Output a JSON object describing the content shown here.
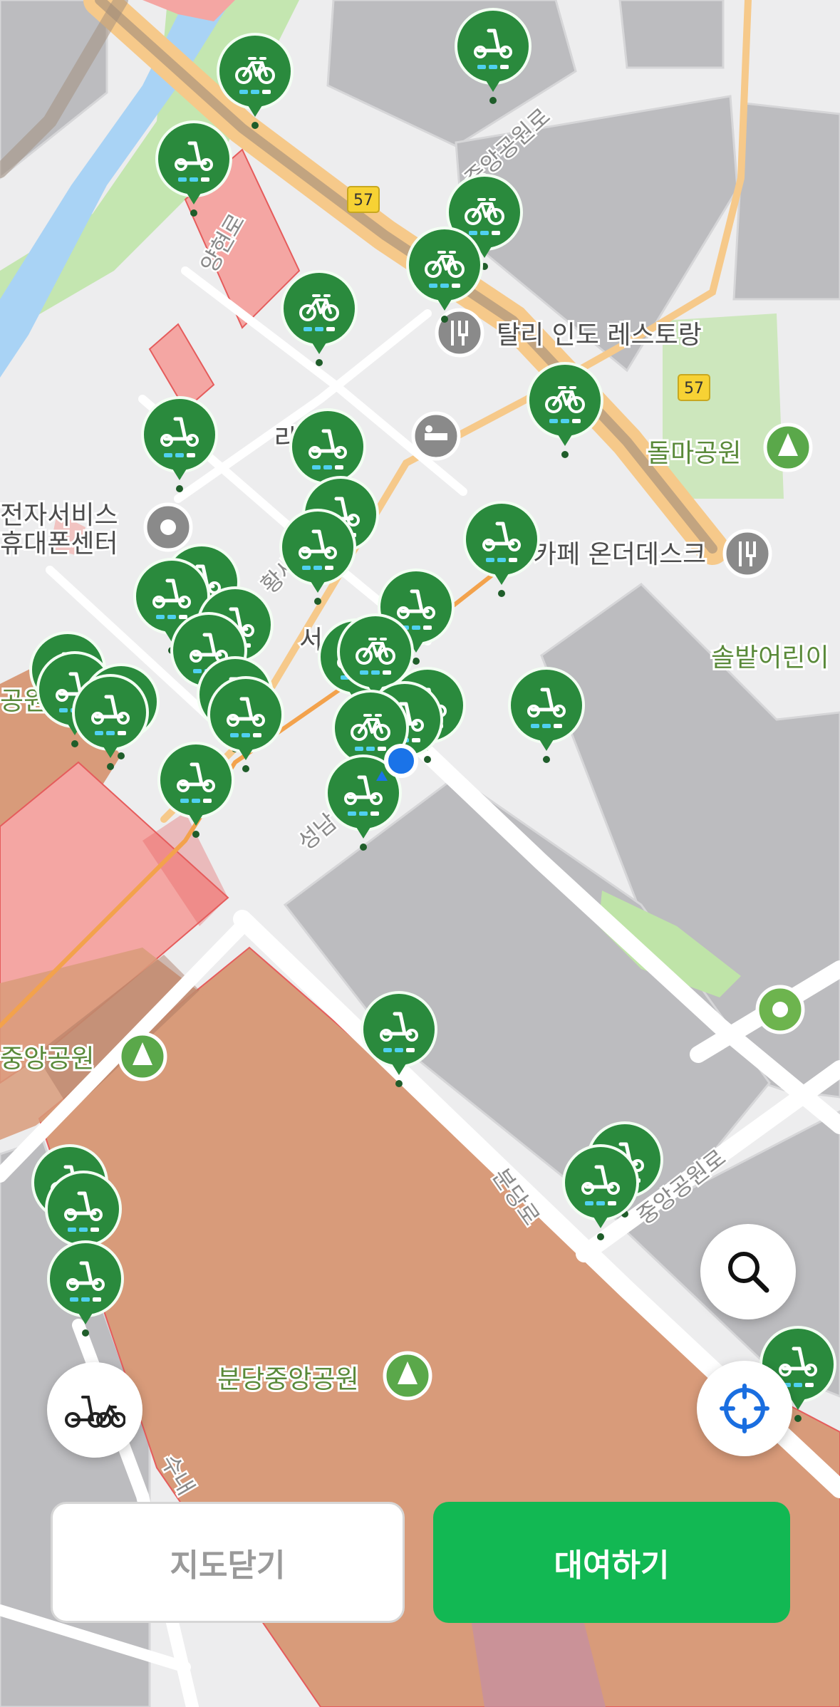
{
  "map": {
    "road_names": {
      "yanghyeon_ro": "양현로",
      "central_park_ro_top": "중앙공원로",
      "central_park_ro_bottom": "중앙공원로",
      "bundang_ro": "분당로",
      "seongnam_ro": "성남",
      "hwangsae_ul_ro": "황새",
      "suinae": "수내"
    },
    "route_badges": [
      "57",
      "57"
    ],
    "pois": {
      "tali_indo": "탈리 인도 레스토랑",
      "hotel": "라 호텔",
      "samsung_service_1": "전자서비스",
      "samsung_service_2": "휴대폰센터",
      "dolma_park": "돌마공원",
      "cafe": "카페 온더데스크",
      "solbat": "솔밭어린이",
      "central_park_left": "중앙공원",
      "bundang_central_park": "분당중앙공원",
      "left_edge_park": "공원",
      "seohyeon": "서"
    }
  },
  "controls": {
    "vehicle_filter_icon": "scooter-bike-icon",
    "search_icon": "search-icon",
    "locate_icon": "crosshair-icon"
  },
  "buttons": {
    "close_map": "지도닫기",
    "rent": "대여하기"
  },
  "colors": {
    "marker_green": "#2a8a3d",
    "rent_green": "#12b853",
    "park_green": "#bfe4a8",
    "water_blue": "#a9d3f5",
    "road_orange": "#f6c98a",
    "zone_red": "#f4a6a3",
    "zone_orange": "#d89b7a",
    "location_blue": "#1a73e8"
  }
}
